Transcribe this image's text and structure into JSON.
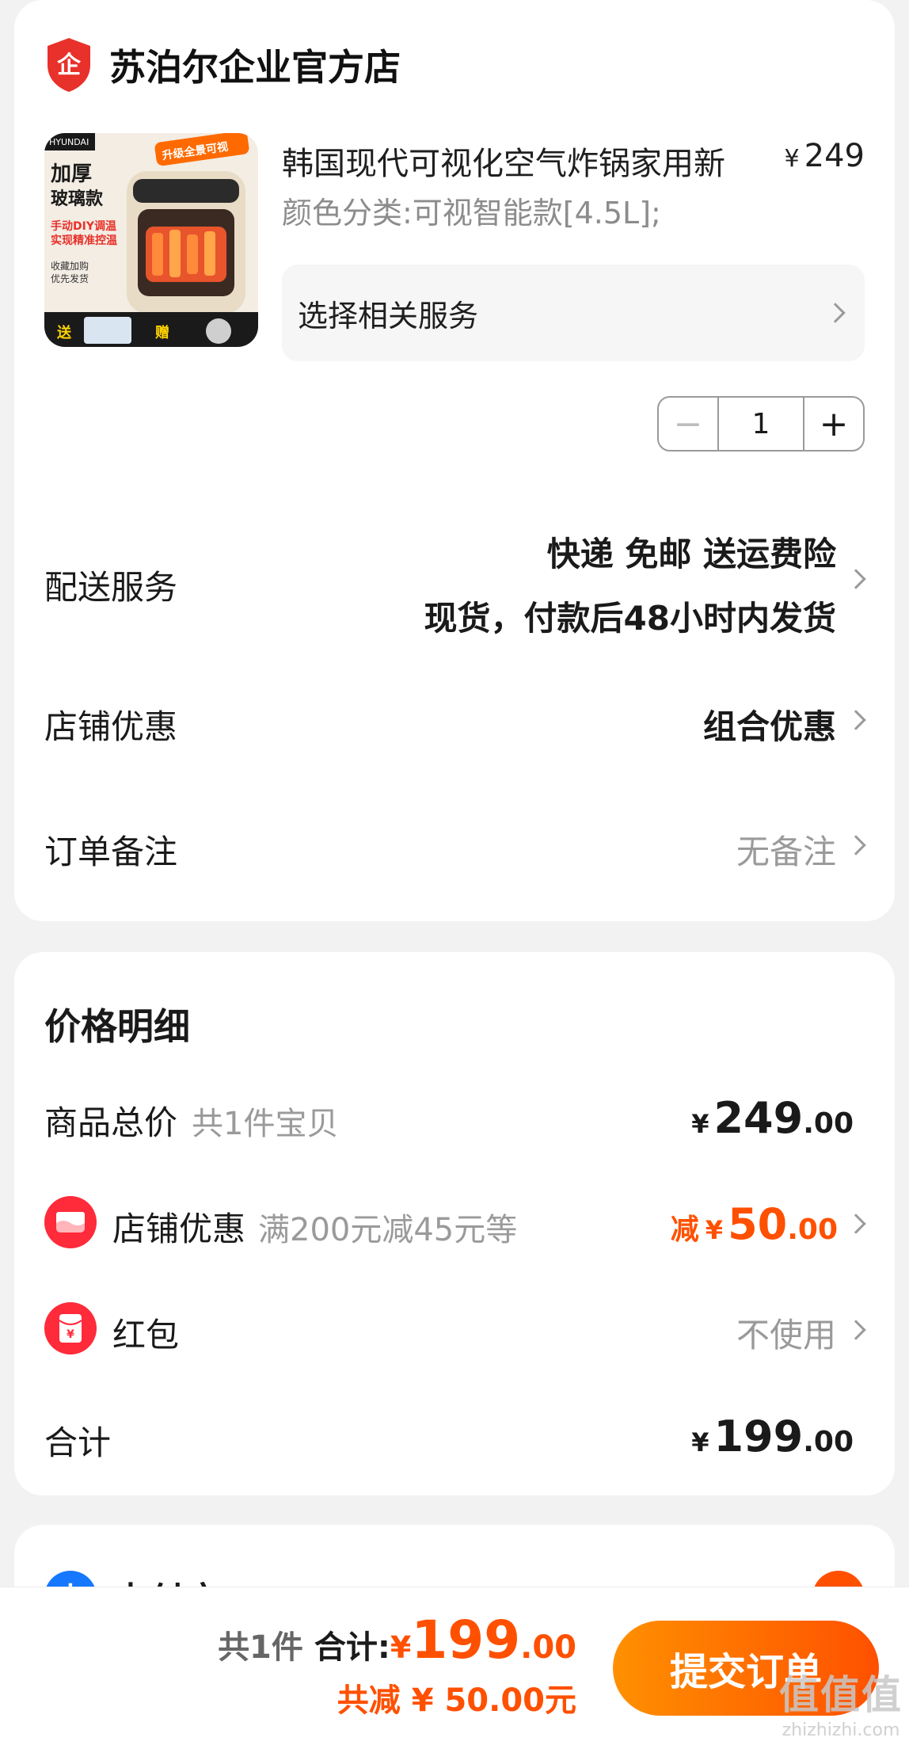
{
  "store": {
    "name": "苏泊尔企业官方店"
  },
  "product": {
    "title": "韩国现代可视化空气炸锅家用新",
    "price_symbol": "¥",
    "price": "249",
    "spec": "颜色分类:可视智能款[4.5L];",
    "service_label": "选择相关服务",
    "quantity": "1",
    "image_texts": {
      "brand": "HYUNDAI",
      "badge": "升级全景可视",
      "line1": "加厚",
      "line2": "玻璃款",
      "line3": "手动DIY调温",
      "line4": "实现精准控温",
      "line5": "收藏加购",
      "line6": "优先发货",
      "gift1": "送",
      "gift2": "赠"
    }
  },
  "order_rows": {
    "delivery": {
      "label": "配送服务",
      "line1": "快递 免邮 送运费险",
      "line2": "现货，付款后48小时内发货"
    },
    "store_discount": {
      "label": "店铺优惠",
      "value": "组合优惠"
    },
    "note": {
      "label": "订单备注",
      "value": "无备注"
    }
  },
  "price_detail": {
    "title": "价格明细",
    "subtotal": {
      "label": "商品总价",
      "sub": "共1件宝贝",
      "symbol": "¥",
      "int": "249",
      "dec": ".00"
    },
    "discount": {
      "label": "店铺优惠",
      "sub": "满200元减45元等",
      "prefix": "减",
      "symbol": "¥",
      "int": "50",
      "dec": ".00"
    },
    "red_packet": {
      "label": "红包",
      "value": "不使用",
      "icon_char": "¥"
    },
    "total": {
      "label": "合计",
      "symbol": "¥",
      "int": "199",
      "dec": ".00"
    }
  },
  "payment": {
    "method": "支付宝",
    "icon_char": "支"
  },
  "bottom_bar": {
    "count": "共1件",
    "total_label": "合计:",
    "symbol": "¥",
    "int": "199",
    "dec": ".00",
    "saved": "共减 ¥ 50.00元",
    "submit": "提交订单"
  },
  "watermark": {
    "main": "值值值",
    "sub": "zhizhizhi.com"
  },
  "colors": {
    "accent": "#ff5000",
    "accent_start": "#ff9000",
    "red": "#ff2a3a",
    "alipay": "#1677ff"
  },
  "icons": [
    "enterprise-shield-icon",
    "chevron-right-icon",
    "minus-icon",
    "plus-icon",
    "store-coupon-icon",
    "red-packet-icon",
    "alipay-icon",
    "check-icon"
  ]
}
